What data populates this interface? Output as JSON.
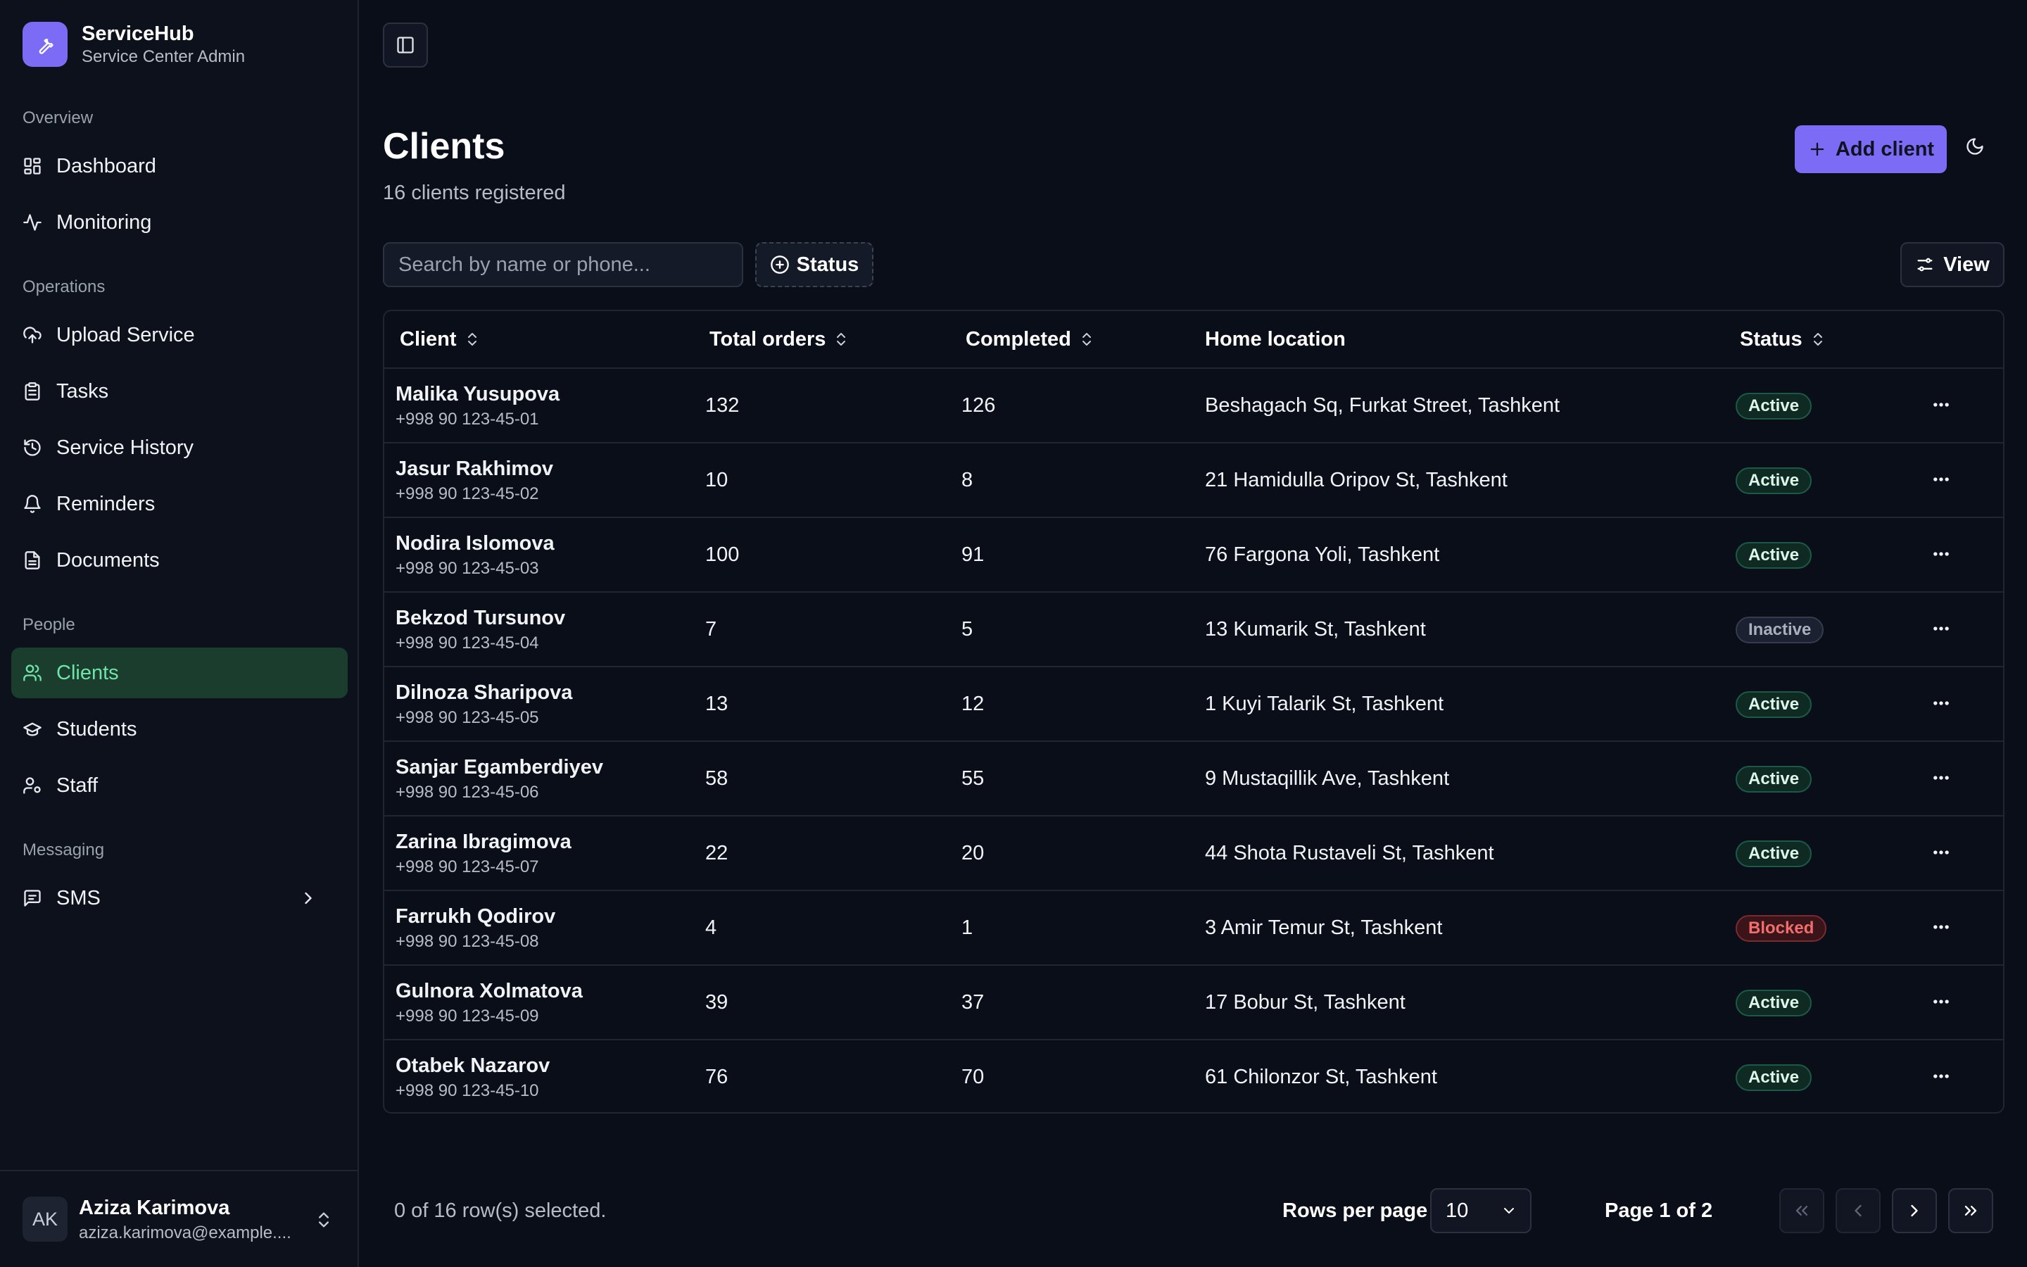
{
  "brand": {
    "name": "ServiceHub",
    "subtitle": "Service Center Admin"
  },
  "sidebar": {
    "groups": [
      {
        "label": "Overview",
        "items": [
          {
            "label": "Dashboard",
            "icon": "dashboard-icon"
          },
          {
            "label": "Monitoring",
            "icon": "activity-icon"
          }
        ]
      },
      {
        "label": "Operations",
        "items": [
          {
            "label": "Upload Service",
            "icon": "cloud-upload-icon"
          },
          {
            "label": "Tasks",
            "icon": "clipboard-icon"
          },
          {
            "label": "Service History",
            "icon": "history-icon"
          },
          {
            "label": "Reminders",
            "icon": "bell-icon"
          },
          {
            "label": "Documents",
            "icon": "document-icon"
          }
        ]
      },
      {
        "label": "People",
        "items": [
          {
            "label": "Clients",
            "icon": "users-icon",
            "active": true
          },
          {
            "label": "Students",
            "icon": "graduation-cap-icon"
          },
          {
            "label": "Staff",
            "icon": "user-cog-icon"
          }
        ]
      },
      {
        "label": "Messaging",
        "items": [
          {
            "label": "SMS",
            "icon": "message-icon"
          }
        ]
      }
    ]
  },
  "user": {
    "initials": "AK",
    "name": "Aziza Karimova",
    "email": "aziza.karimova@example...."
  },
  "header": {
    "title": "Clients",
    "subtitle": "16 clients registered",
    "add_label": "Add client"
  },
  "toolbar": {
    "search_placeholder": "Search by name or phone...",
    "status_label": "Status",
    "view_label": "View"
  },
  "table": {
    "columns": {
      "client": "Client",
      "total": "Total orders",
      "completed": "Completed",
      "location": "Home location",
      "status": "Status"
    },
    "rows": [
      {
        "name": "Malika Yusupova",
        "phone": "+998 90 123-45-01",
        "total": "132",
        "completed": "126",
        "location": "Beshagach Sq, Furkat Street, Tashkent",
        "status": "Active"
      },
      {
        "name": "Jasur Rakhimov",
        "phone": "+998 90 123-45-02",
        "total": "10",
        "completed": "8",
        "location": "21 Hamidulla Oripov St, Tashkent",
        "status": "Active"
      },
      {
        "name": "Nodira Islomova",
        "phone": "+998 90 123-45-03",
        "total": "100",
        "completed": "91",
        "location": "76 Fargona Yoli, Tashkent",
        "status": "Active"
      },
      {
        "name": "Bekzod Tursunov",
        "phone": "+998 90 123-45-04",
        "total": "7",
        "completed": "5",
        "location": "13 Kumarik St, Tashkent",
        "status": "Inactive"
      },
      {
        "name": "Dilnoza Sharipova",
        "phone": "+998 90 123-45-05",
        "total": "13",
        "completed": "12",
        "location": "1 Kuyi Talarik St, Tashkent",
        "status": "Active"
      },
      {
        "name": "Sanjar Egamberdiyev",
        "phone": "+998 90 123-45-06",
        "total": "58",
        "completed": "55",
        "location": "9 Mustaqillik Ave, Tashkent",
        "status": "Active"
      },
      {
        "name": "Zarina Ibragimova",
        "phone": "+998 90 123-45-07",
        "total": "22",
        "completed": "20",
        "location": "44 Shota Rustaveli St, Tashkent",
        "status": "Active"
      },
      {
        "name": "Farrukh Qodirov",
        "phone": "+998 90 123-45-08",
        "total": "4",
        "completed": "1",
        "location": "3 Amir Temur St, Tashkent",
        "status": "Blocked"
      },
      {
        "name": "Gulnora Xolmatova",
        "phone": "+998 90 123-45-09",
        "total": "39",
        "completed": "37",
        "location": "17 Bobur St, Tashkent",
        "status": "Active"
      },
      {
        "name": "Otabek Nazarov",
        "phone": "+998 90 123-45-10",
        "total": "76",
        "completed": "70",
        "location": "61 Chilonzor St, Tashkent",
        "status": "Active"
      }
    ]
  },
  "footer": {
    "selected": "0 of 16 row(s) selected.",
    "rows_per_page_label": "Rows per page",
    "rows_per_page_value": "10",
    "page_info": "Page 1 of 2"
  },
  "colors": {
    "accent": "#7c6cf5",
    "active_nav_bg": "#1a3d2d",
    "active_nav_text": "#6ee4a9",
    "blocked": "#f26d6d"
  }
}
